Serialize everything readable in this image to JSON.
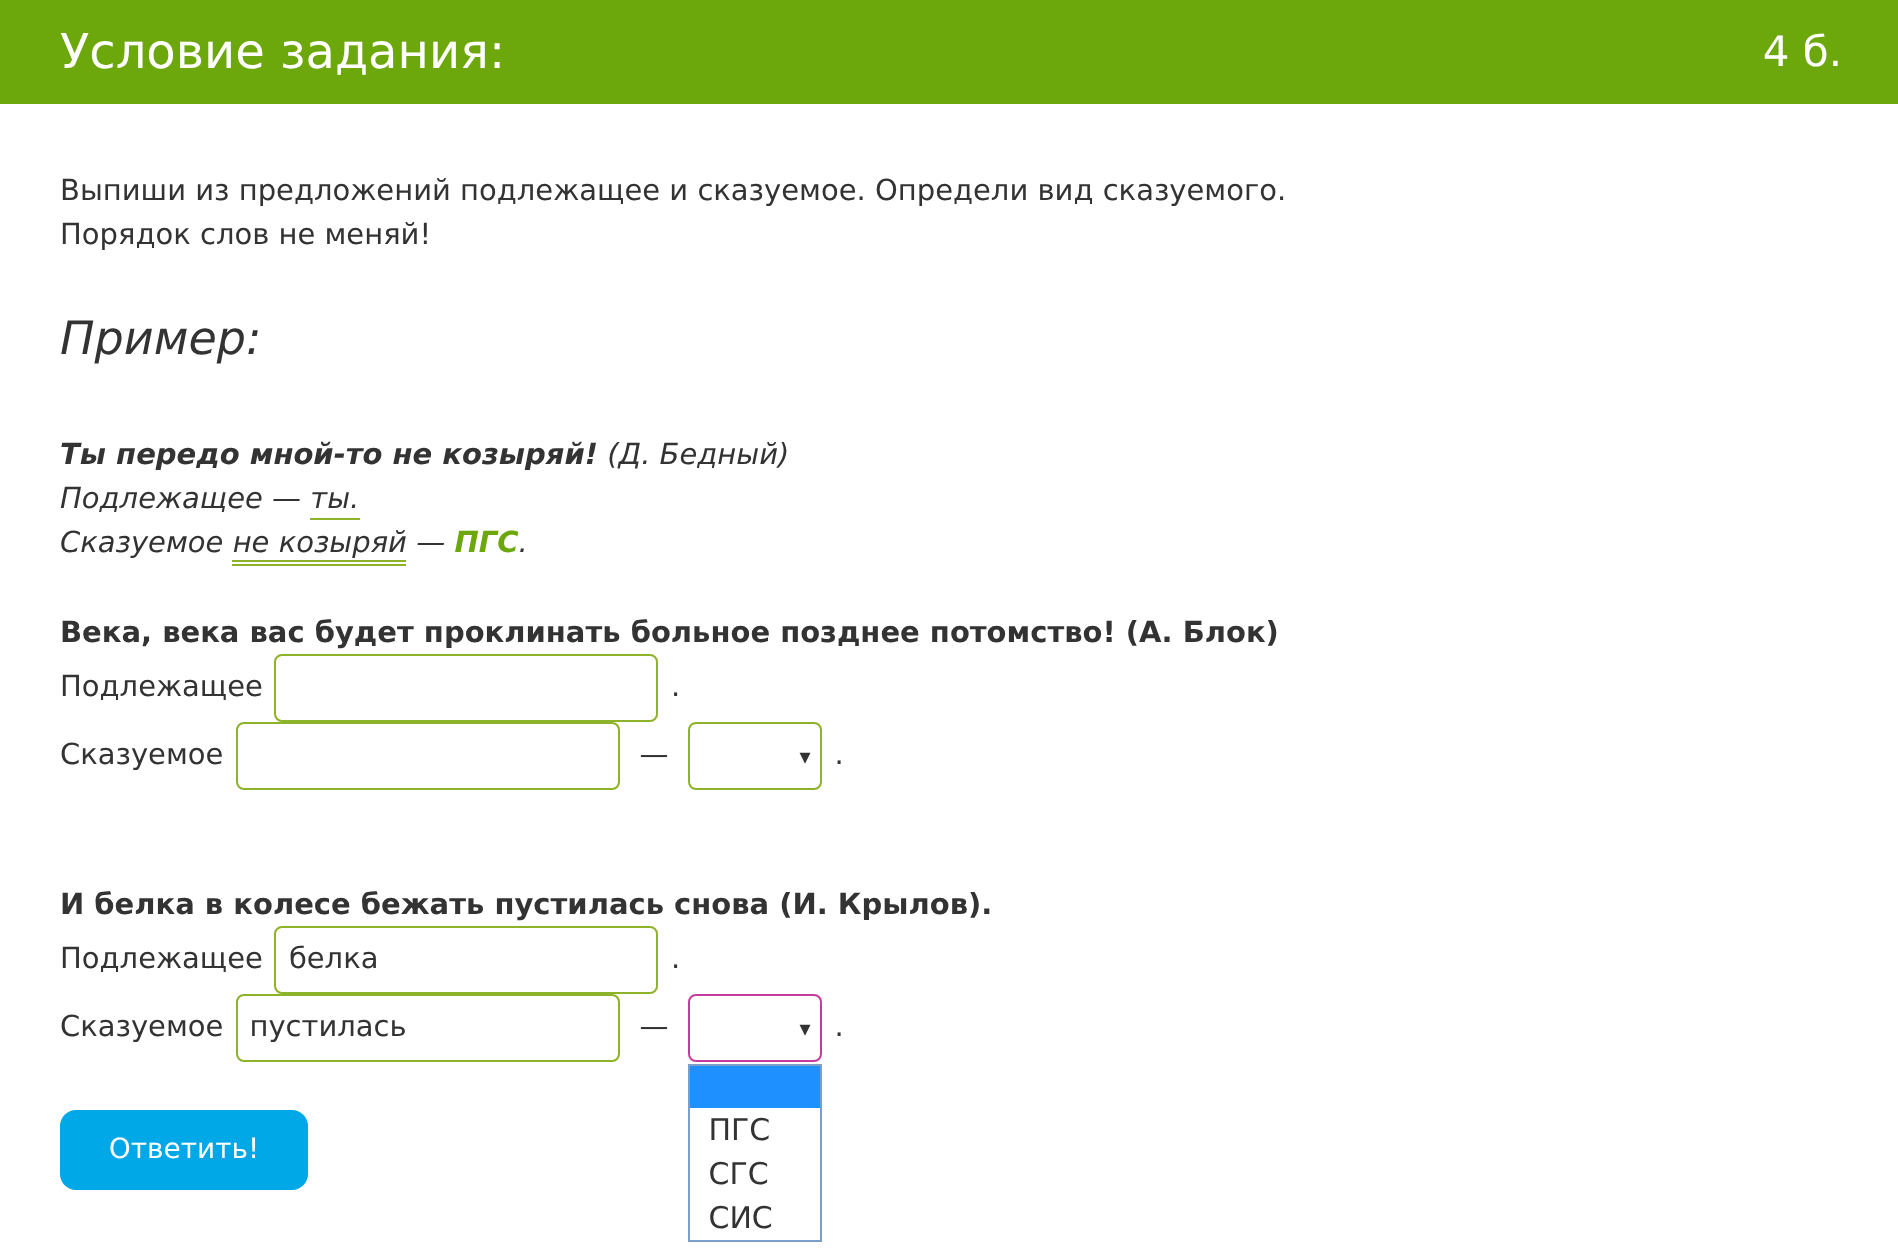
{
  "header": {
    "title": "Условие задания:",
    "points": "4 б."
  },
  "instruction": [
    "Выпиши из предложений подлежащее и сказуемое. Определи вид сказуемого.",
    "Порядок слов не меняй!"
  ],
  "example": {
    "heading": "Пример:",
    "sentence": "**Ты передо мной-то не козыряй!** (Д. Бедный)",
    "lines": [
      {
        "kind": "subject",
        "label": "Подлежащее —",
        "answer": "ты."
      },
      {
        "kind": "predicate",
        "label": "Сказуемое",
        "answer": "не козыряй",
        "dash": "—",
        "type": "ПГС",
        "end": "."
      }
    ]
  },
  "questions": [
    {
      "sentence": "Века, века вас будет проклинать больное позднее потомство! (А. Блок)",
      "subject": {
        "label": "Подлежащее",
        "end": "."
      },
      "predicate": {
        "label": "Сказуемое",
        "dash": "—",
        "end": ".",
        "select": {
          "arrow": "▾",
          "focused": false,
          "open": false
        }
      }
    },
    {
      "sentence": "И белка в колесе бежать пустилась снова (И. Крылов).",
      "subject": {
        "label": "Подлежащее",
        "value": "белка",
        "end": "."
      },
      "predicate": {
        "label": "Сказуемое",
        "value": "пустилась",
        "dash": "—",
        "end": ".",
        "select": {
          "arrow": "▾",
          "focused": true,
          "open": true,
          "blank_highlighted": true,
          "options": [
            "ПГС",
            "СГС",
            "СИС"
          ]
        }
      }
    }
  ],
  "button": "Ответить!"
}
